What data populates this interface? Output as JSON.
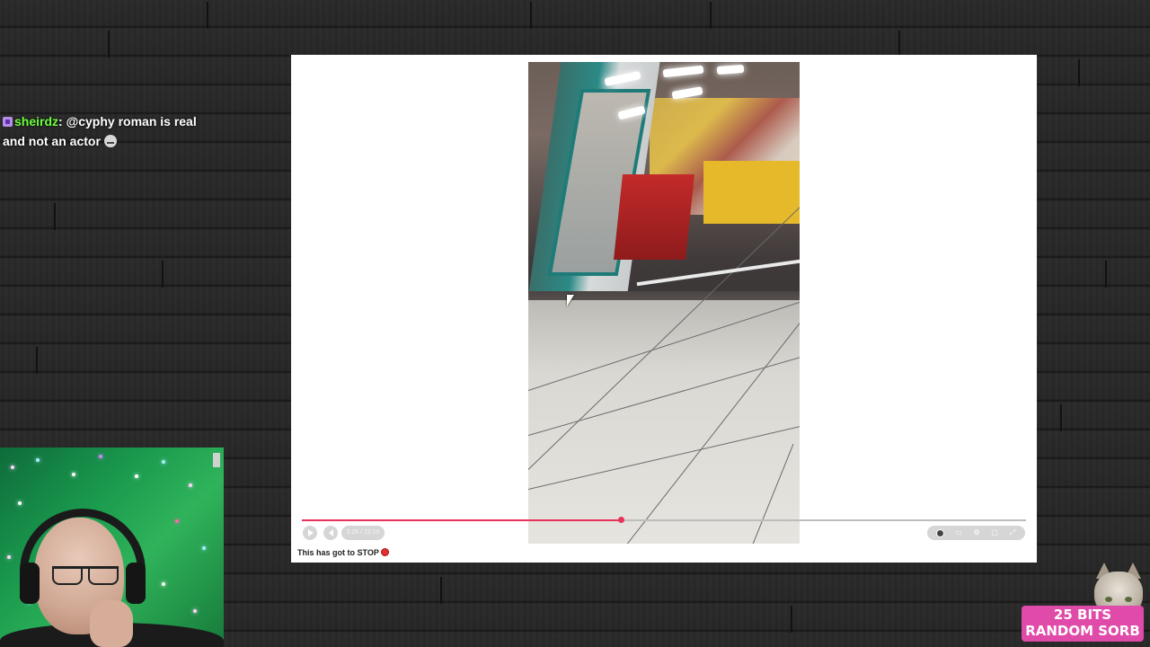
{
  "chat": {
    "username": "sheirdz",
    "separator": ":",
    "message": "@cyphy roman is real and not an actor"
  },
  "player": {
    "time": "3:25 / 12:10",
    "progress_fraction": 0.44,
    "title": "This has got to STOP"
  },
  "alert": {
    "bits_line": "25 BITS",
    "sub_line": "RANDOM SORB"
  },
  "colors": {
    "progress": "#e8315b",
    "username": "#6cff3d",
    "alert_bg": "#e04aa8"
  }
}
